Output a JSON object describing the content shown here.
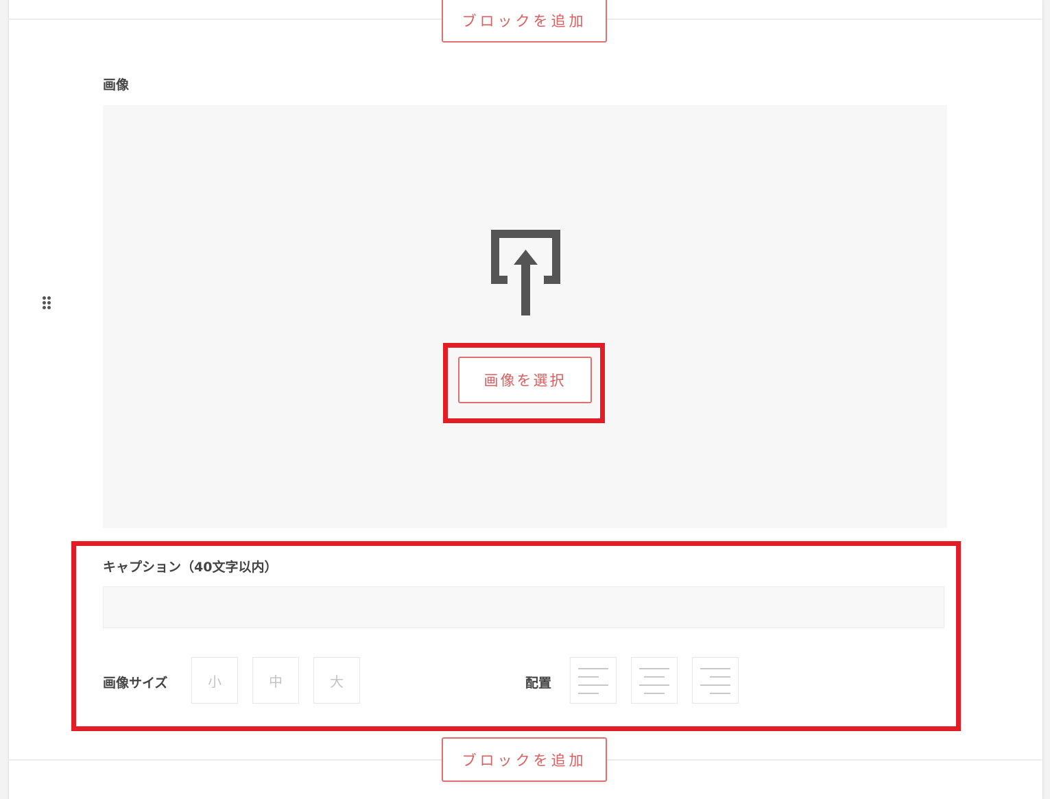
{
  "blocks": {
    "add_block_label": "ブロックを追加"
  },
  "image_block": {
    "title": "画像",
    "select_button": "画像を選択",
    "caption_label": "キャプション（40文字以内）",
    "caption_value": "",
    "size_label": "画像サイズ",
    "size_options": [
      "小",
      "中",
      "大"
    ],
    "align_label": "配置",
    "align_options": [
      "align-left",
      "align-center",
      "align-right"
    ]
  },
  "colors": {
    "accent": "#dc5e5e",
    "highlight": "#e31d26",
    "icon": "#555555"
  }
}
